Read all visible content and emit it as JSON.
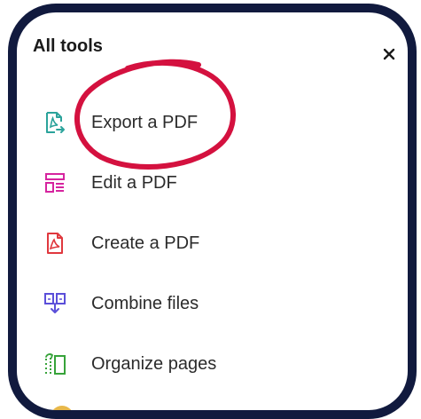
{
  "panel": {
    "title": "All tools",
    "close_symbol": "×"
  },
  "tools": [
    {
      "label": "Export a PDF",
      "icon": "export-pdf-icon",
      "color": "#2ba39b"
    },
    {
      "label": "Edit a PDF",
      "icon": "edit-pdf-icon",
      "color": "#d6249f"
    },
    {
      "label": "Create a PDF",
      "icon": "create-pdf-icon",
      "color": "#e0383e"
    },
    {
      "label": "Combine files",
      "icon": "combine-files-icon",
      "color": "#5b4fd9"
    },
    {
      "label": "Organize pages",
      "icon": "organize-pages-icon",
      "color": "#37a33a"
    }
  ],
  "annotation": {
    "type": "hand-drawn-circle",
    "target": "Export a PDF",
    "color": "#d4113f"
  },
  "colors": {
    "frame_border": "#111a3e",
    "peek_icon": "#e8b84a"
  }
}
